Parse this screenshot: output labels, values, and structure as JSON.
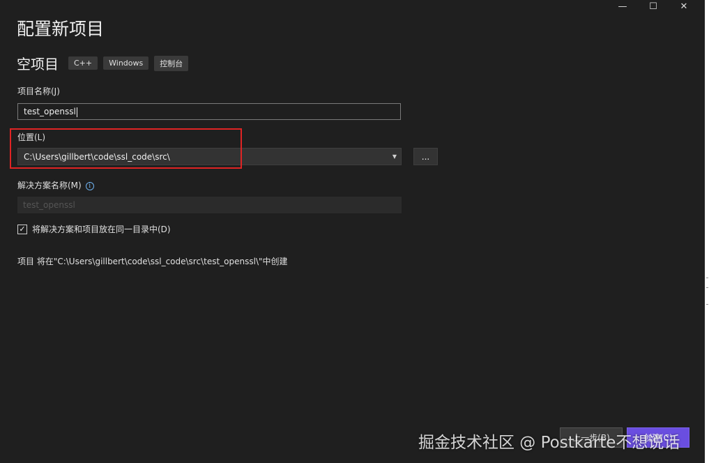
{
  "window": {
    "minimize_glyph": "—",
    "maximize_glyph": "☐",
    "close_glyph": "✕"
  },
  "page": {
    "title": "配置新项目",
    "template_name": "空项目",
    "tags": [
      "C++",
      "Windows",
      "控制台"
    ]
  },
  "form": {
    "project_name_label": "项目名称(J)",
    "project_name_value": "test_openssl",
    "location_label": "位置(L)",
    "location_value": "C:\\Users\\gillbert\\code\\ssl_code\\src\\",
    "browse_label": "...",
    "solution_name_label": "解决方案名称(M)",
    "solution_name_value": "test_openssl",
    "same_dir_checkbox_label": "将解决方案和项目放在同一目录中(D)",
    "same_dir_checked": true,
    "summary_text": "项目 将在\"C:\\Users\\gillbert\\code\\ssl_code\\src\\test_openssl\\\"中创建"
  },
  "footer": {
    "back_label": "上一步(B)",
    "create_label": "创建(C)"
  },
  "watermark": "掘金技术社区 @ Postkarte不想说话",
  "colors": {
    "background": "#1f1f1f",
    "accent": "#6a4ee0",
    "highlight": "#e02424",
    "info": "#6fb3f2"
  }
}
